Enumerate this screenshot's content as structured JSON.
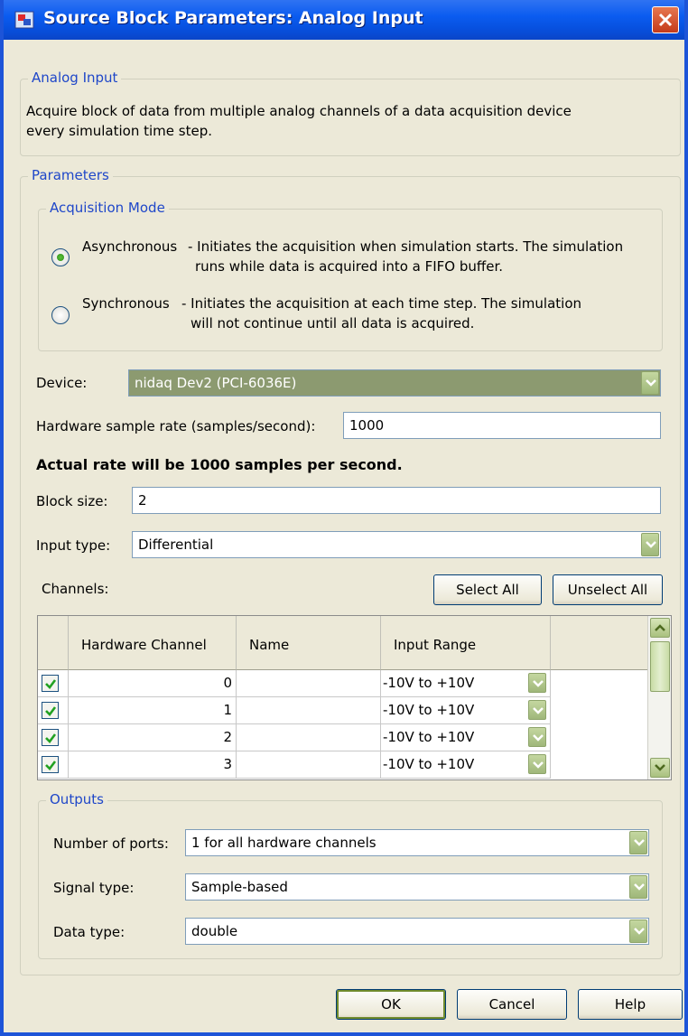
{
  "window": {
    "title": "Source Block Parameters: Analog Input"
  },
  "description_group": {
    "legend": "Analog Input",
    "line1": "Acquire block of data from multiple analog channels of a data acquisition device",
    "line2": "every simulation time step."
  },
  "parameters_group": {
    "legend": "Parameters"
  },
  "acquisition_mode": {
    "legend": "Acquisition Mode",
    "async_label": "Asynchronous",
    "async_desc1": "- Initiates the acquisition when simulation starts. The simulation",
    "async_desc2": "runs while data is acquired into a FIFO buffer.",
    "sync_label": "Synchronous",
    "sync_desc1": "- Initiates the acquisition at each time step. The simulation",
    "sync_desc2": "will not continue until all data is acquired.",
    "selected": "Asynchronous"
  },
  "device": {
    "label": "Device:",
    "value": "nidaq Dev2 (PCI-6036E)"
  },
  "sample_rate": {
    "label": "Hardware sample rate (samples/second):",
    "value": "1000",
    "actual_rate_text": "Actual rate will be 1000 samples per second."
  },
  "block_size": {
    "label": "Block size:",
    "value": "2"
  },
  "input_type": {
    "label": "Input type:",
    "value": "Differential"
  },
  "channels": {
    "label": "Channels:",
    "select_all": "Select All",
    "unselect_all": "Unselect All",
    "headers": {
      "hw_channel": "Hardware Channel",
      "name": "Name",
      "input_range": "Input Range"
    },
    "rows": [
      {
        "checked": true,
        "hw_channel": "0",
        "name": "",
        "input_range": "-10V to +10V"
      },
      {
        "checked": true,
        "hw_channel": "1",
        "name": "",
        "input_range": "-10V to +10V"
      },
      {
        "checked": true,
        "hw_channel": "2",
        "name": "",
        "input_range": "-10V to +10V"
      },
      {
        "checked": true,
        "hw_channel": "3",
        "name": "",
        "input_range": "-10V to +10V"
      }
    ]
  },
  "outputs": {
    "legend": "Outputs",
    "ports_label": "Number of ports:",
    "ports_value": "1 for all hardware channels",
    "signal_label": "Signal type:",
    "signal_value": "Sample-based",
    "data_label": "Data type:",
    "data_value": "double"
  },
  "buttons": {
    "ok": "OK",
    "cancel": "Cancel",
    "help": "Help"
  },
  "colors": {
    "titlebar": "#0b5cf0",
    "legend_text": "#1f47c9",
    "dialog_bg": "#ece9d8",
    "device_bg": "#8c9a70"
  }
}
